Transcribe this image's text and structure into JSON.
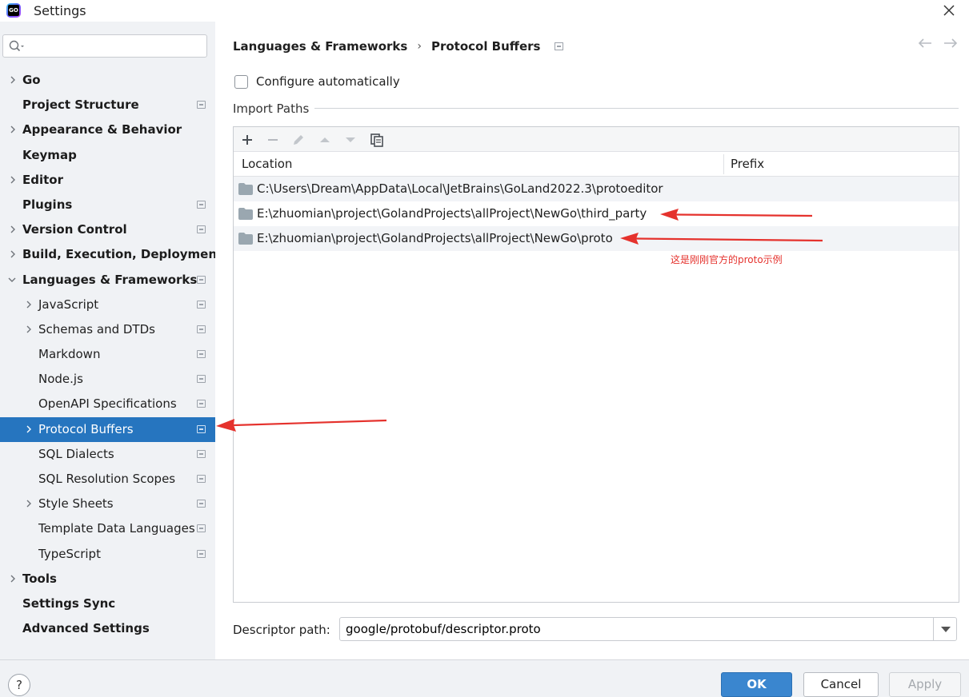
{
  "window": {
    "title": "Settings",
    "logo_text": "GO"
  },
  "search": {
    "placeholder": ""
  },
  "sidebar": {
    "items": [
      {
        "label": "Go"
      },
      {
        "label": "Project Structure"
      },
      {
        "label": "Appearance & Behavior"
      },
      {
        "label": "Keymap"
      },
      {
        "label": "Editor"
      },
      {
        "label": "Plugins"
      },
      {
        "label": "Version Control"
      },
      {
        "label": "Build, Execution, Deployment"
      },
      {
        "label": "Languages & Frameworks"
      },
      {
        "label": "JavaScript"
      },
      {
        "label": "Schemas and DTDs"
      },
      {
        "label": "Markdown"
      },
      {
        "label": "Node.js"
      },
      {
        "label": "OpenAPI Specifications"
      },
      {
        "label": "Protocol Buffers"
      },
      {
        "label": "SQL Dialects"
      },
      {
        "label": "SQL Resolution Scopes"
      },
      {
        "label": "Style Sheets"
      },
      {
        "label": "Template Data Languages"
      },
      {
        "label": "TypeScript"
      },
      {
        "label": "Tools"
      },
      {
        "label": "Settings Sync"
      },
      {
        "label": "Advanced Settings"
      }
    ]
  },
  "breadcrumb": {
    "parent": "Languages & Frameworks",
    "current": "Protocol Buffers"
  },
  "configure": {
    "label": "Configure automatically",
    "checked": false
  },
  "import_paths": {
    "title": "Import Paths",
    "columns": [
      "Location",
      "Prefix"
    ],
    "rows": [
      {
        "location": "C:\\Users\\Dream\\AppData\\Local\\JetBrains\\GoLand2022.3\\protoeditor",
        "prefix": ""
      },
      {
        "location": "E:\\zhuomian\\project\\GolandProjects\\allProject\\NewGo\\third_party",
        "prefix": ""
      },
      {
        "location": "E:\\zhuomian\\project\\GolandProjects\\allProject\\NewGo\\proto",
        "prefix": ""
      }
    ]
  },
  "annotation": {
    "text": "这是刚刚官方的proto示例",
    "color": "#e5322d"
  },
  "descriptor": {
    "label": "Descriptor path:",
    "value": "google/protobuf/descriptor.proto"
  },
  "footer": {
    "help": "?",
    "ok": "OK",
    "cancel": "Cancel",
    "apply": "Apply"
  },
  "colors": {
    "selection": "#2675bf",
    "ok_button": "#3a86cf",
    "sidebar_bg": "#f0f2f5",
    "arrow": "#e5322d"
  }
}
